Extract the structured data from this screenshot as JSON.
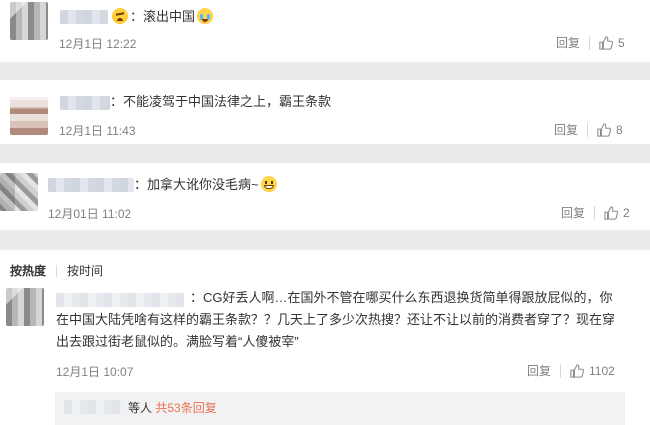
{
  "comments": [
    {
      "text": "滚出中国",
      "time": "12月1日 12:22",
      "reply_label": "回复",
      "likes": "5",
      "emojis": [
        "angry-face",
        "crying-face"
      ]
    },
    {
      "text": "不能凌驾于中国法律之上，霸王条款",
      "time": "12月1日 11:43",
      "reply_label": "回复",
      "likes": "8"
    },
    {
      "text": "加拿大讹你没毛病~",
      "time": "12月01日 11:02",
      "reply_label": "回复",
      "likes": "2",
      "emojis": [
        "grinning-face"
      ]
    },
    {
      "line1": "：CG好丢人啊…在国外不管在哪买什么东西退换货简单得跟放屁似的，你",
      "line2": "在中国大陆凭啥有这样的霸王条款？？几天上了多少次热搜？还让不让以前的消费者穿了？现在穿",
      "line3": "出去跟过街老鼠似的。满脸写着“人傻被宰”",
      "time": "12月1日 10:07",
      "reply_label": "回复",
      "likes": "1102"
    }
  ],
  "sort_tabs": {
    "hot": "按热度",
    "time": "按时间"
  },
  "sub_replies": {
    "prefix": "等人",
    "link": "共53条回复"
  },
  "colors": {
    "link": "#eb7350",
    "muted": "#808080",
    "background": "#ebebeb"
  }
}
